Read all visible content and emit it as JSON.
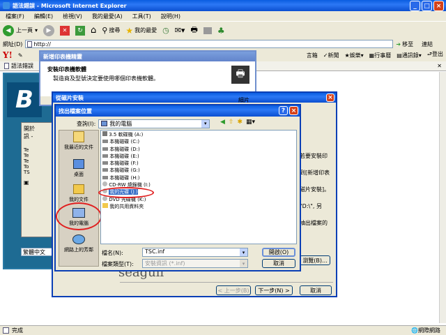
{
  "ie": {
    "title": "語法錯誤 - Microsoft Internet Explorer",
    "menu": [
      "檔案(F)",
      "編輯(E)",
      "檢視(V)",
      "我的最愛(A)",
      "工具(T)",
      "說明(H)"
    ],
    "back": "上一頁",
    "search": "搜尋",
    "favorites": "我的最愛",
    "address_label": "網址(D)",
    "address_value": "http://",
    "go": "移至",
    "links": "連結",
    "yahoo_items": [
      "新聞",
      "娛樂",
      "行事曆",
      "通訊錄",
      "登出"
    ],
    "yahoo_partial": "言箱",
    "tab": "語法錯誤",
    "status": "完成",
    "zone": "網際網路"
  },
  "bg": {
    "lang": "繁體中文",
    "partial_title": "B",
    "left_texts": [
      "開於",
      "訊 -"
    ],
    "list_partial": [
      "Te",
      "Te",
      "Te",
      "To",
      "TS"
    ],
    "checkbox_partial": "▣"
  },
  "wizard": {
    "title": "新增印表機精靈",
    "heading": "安裝印表機軟體",
    "sub": "製造商及型號決定要使用哪個印表機軟體。",
    "right_partial": [
      "細片",
      "機"
    ]
  },
  "install": {
    "title": "從磁片安裝",
    "texts": [
      "若要安裝印",
      "到[新增印表",
      "磁片安裝]。",
      "\"D:\\\", 另",
      "抽出檔案的"
    ],
    "browse": "瀏覽(B)...",
    "brand": "seagull",
    "back": "< 上一步(B)",
    "next": "下一步(N) >",
    "cancel": "取消"
  },
  "finder": {
    "title": "找出檔案位置",
    "look_in_label": "查詢(I):",
    "look_in_value": "我的電腦",
    "places": [
      {
        "label": "我最近的文件"
      },
      {
        "label": "桌面"
      },
      {
        "label": "我的文件"
      },
      {
        "label": "我的電腦"
      },
      {
        "label": "網路上的芳鄰"
      }
    ],
    "items": [
      "3.5 軟碟機 (A:)",
      "本機磁碟 (C:)",
      "本機磁碟 (D:)",
      "本機磁碟 (E:)",
      "本機磁碟 (F:)",
      "本機磁碟 (G:)",
      "本機磁碟 (H:)",
      "CD-RW 燒錄機 (I:)",
      "我的光碟 (J:)",
      "DVD 光碟機 (K:)",
      "我的共用資料夾"
    ],
    "selected_index": 8,
    "filename_label": "檔名(N):",
    "filename_value": "TSC.inf",
    "filetype_label": "檔案類型(T):",
    "filetype_value": "安裝資訊 (*.inf)",
    "open": "開啟(O)",
    "cancel": "取消"
  },
  "colors": {
    "xp_blue": "#0b5bd7",
    "highlight": "#e01f1f",
    "face": "#ece9d8"
  }
}
